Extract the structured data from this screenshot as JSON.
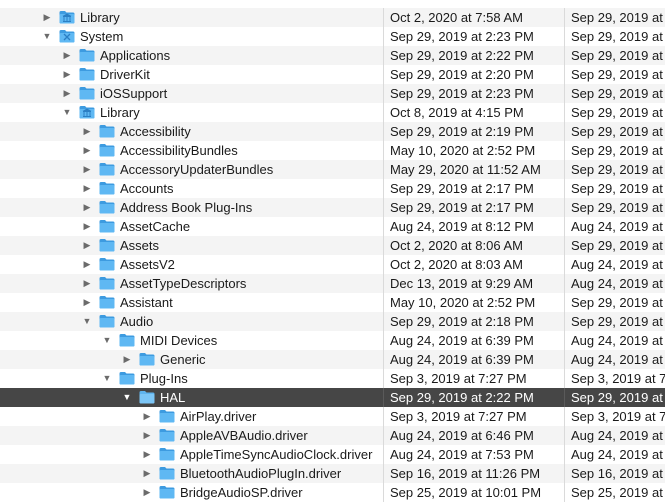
{
  "folder_color": "#5fb8f3",
  "folder_color_dark": "#3d9be0",
  "rows": [
    {
      "name": "Library",
      "depth": 0,
      "expanded": false,
      "icon": "library-folder-icon",
      "modified": "Oct 2, 2020 at 7:58 AM",
      "created": "Sep 29, 2019 at"
    },
    {
      "name": "System",
      "depth": 0,
      "expanded": true,
      "icon": "system-folder-icon",
      "modified": "Sep 29, 2019 at 2:23 PM",
      "created": "Sep 29, 2019 at"
    },
    {
      "name": "Applications",
      "depth": 1,
      "expanded": false,
      "icon": "folder-icon",
      "modified": "Sep 29, 2019 at 2:22 PM",
      "created": "Sep 29, 2019 at"
    },
    {
      "name": "DriverKit",
      "depth": 1,
      "expanded": false,
      "icon": "folder-icon",
      "modified": "Sep 29, 2019 at 2:20 PM",
      "created": "Sep 29, 2019 at"
    },
    {
      "name": "iOSSupport",
      "depth": 1,
      "expanded": false,
      "icon": "folder-icon",
      "modified": "Sep 29, 2019 at 2:23 PM",
      "created": "Sep 29, 2019 at"
    },
    {
      "name": "Library",
      "depth": 1,
      "expanded": true,
      "icon": "library-folder-icon",
      "modified": "Oct 8, 2019 at 4:15 PM",
      "created": "Sep 29, 2019 at"
    },
    {
      "name": "Accessibility",
      "depth": 2,
      "expanded": false,
      "icon": "folder-icon",
      "modified": "Sep 29, 2019 at 2:19 PM",
      "created": "Sep 29, 2019 at"
    },
    {
      "name": "AccessibilityBundles",
      "depth": 2,
      "expanded": false,
      "icon": "folder-icon",
      "modified": "May 10, 2020 at 2:52 PM",
      "created": "Sep 29, 2019 at"
    },
    {
      "name": "AccessoryUpdaterBundles",
      "depth": 2,
      "expanded": false,
      "icon": "folder-icon",
      "modified": "May 29, 2020 at 11:52 AM",
      "created": "Sep 29, 2019 at"
    },
    {
      "name": "Accounts",
      "depth": 2,
      "expanded": false,
      "icon": "folder-icon",
      "modified": "Sep 29, 2019 at 2:17 PM",
      "created": "Sep 29, 2019 at"
    },
    {
      "name": "Address Book Plug-Ins",
      "depth": 2,
      "expanded": false,
      "icon": "folder-icon",
      "modified": "Sep 29, 2019 at 2:17 PM",
      "created": "Sep 29, 2019 at"
    },
    {
      "name": "AssetCache",
      "depth": 2,
      "expanded": false,
      "icon": "folder-icon",
      "modified": "Aug 24, 2019 at 8:12 PM",
      "created": "Aug 24, 2019 at"
    },
    {
      "name": "Assets",
      "depth": 2,
      "expanded": false,
      "icon": "folder-icon",
      "modified": "Oct 2, 2020 at 8:06 AM",
      "created": "Sep 29, 2019 at"
    },
    {
      "name": "AssetsV2",
      "depth": 2,
      "expanded": false,
      "icon": "folder-icon",
      "modified": "Oct 2, 2020 at 8:03 AM",
      "created": "Aug 24, 2019 at"
    },
    {
      "name": "AssetTypeDescriptors",
      "depth": 2,
      "expanded": false,
      "icon": "folder-icon",
      "modified": "Dec 13, 2019 at 9:29 AM",
      "created": "Aug 24, 2019 at"
    },
    {
      "name": "Assistant",
      "depth": 2,
      "expanded": false,
      "icon": "folder-icon",
      "modified": "May 10, 2020 at 2:52 PM",
      "created": "Sep 29, 2019 at"
    },
    {
      "name": "Audio",
      "depth": 2,
      "expanded": true,
      "icon": "folder-icon",
      "modified": "Sep 29, 2019 at 2:18 PM",
      "created": "Sep 29, 2019 at"
    },
    {
      "name": "MIDI Devices",
      "depth": 3,
      "expanded": true,
      "icon": "folder-icon",
      "modified": "Aug 24, 2019 at 6:39 PM",
      "created": "Aug 24, 2019 at"
    },
    {
      "name": "Generic",
      "depth": 4,
      "expanded": false,
      "icon": "folder-icon",
      "modified": "Aug 24, 2019 at 6:39 PM",
      "created": "Aug 24, 2019 at"
    },
    {
      "name": "Plug-Ins",
      "depth": 3,
      "expanded": true,
      "icon": "folder-icon",
      "modified": "Sep 3, 2019 at 7:27 PM",
      "created": "Sep 3, 2019 at 7"
    },
    {
      "name": "HAL",
      "depth": 4,
      "expanded": true,
      "selected": true,
      "icon": "folder-icon",
      "modified": "Sep 29, 2019 at 2:22 PM",
      "created": "Sep 29, 2019 at"
    },
    {
      "name": "AirPlay.driver",
      "depth": 5,
      "expanded": false,
      "icon": "folder-icon",
      "modified": "Sep 3, 2019 at 7:27 PM",
      "created": "Sep 3, 2019 at 7"
    },
    {
      "name": "AppleAVBAudio.driver",
      "depth": 5,
      "expanded": false,
      "icon": "folder-icon",
      "modified": "Aug 24, 2019 at 6:46 PM",
      "created": "Aug 24, 2019 at"
    },
    {
      "name": "AppleTimeSyncAudioClock.driver",
      "depth": 5,
      "expanded": false,
      "icon": "folder-icon",
      "modified": "Aug 24, 2019 at 7:53 PM",
      "created": "Aug 24, 2019 at"
    },
    {
      "name": "BluetoothAudioPlugIn.driver",
      "depth": 5,
      "expanded": false,
      "icon": "folder-icon",
      "modified": "Sep 16, 2019 at 11:26 PM",
      "created": "Sep 16, 2019 at"
    },
    {
      "name": "BridgeAudioSP.driver",
      "depth": 5,
      "expanded": false,
      "icon": "folder-icon",
      "modified": "Sep 25, 2019 at 10:01 PM",
      "created": "Sep 25, 2019 at"
    }
  ]
}
